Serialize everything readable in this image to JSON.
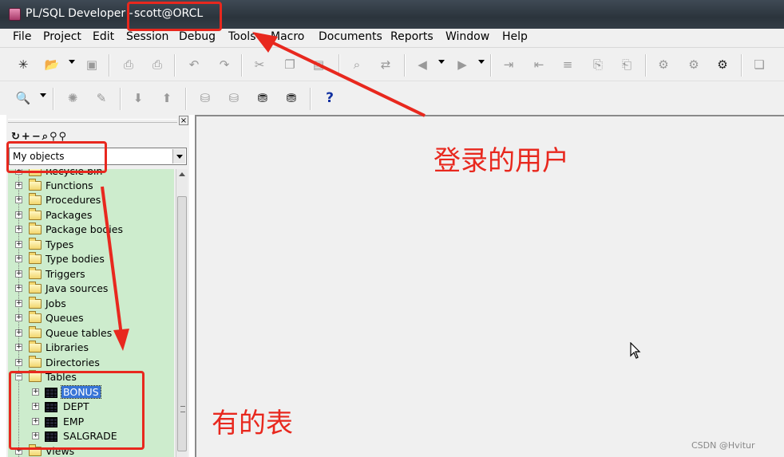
{
  "window": {
    "title_app": "PL/SQL Developer - ",
    "title_user": "scott@ORCL"
  },
  "menu": [
    "File",
    "Project",
    "Edit",
    "Session",
    "Debug",
    "Tools",
    "Macro",
    "Documents",
    "Reports",
    "Window",
    "Help"
  ],
  "toolbar1": {
    "buttons": [
      "new-icon",
      "open-icon",
      "save-icon",
      "print-icon",
      "print-preview-icon",
      "undo-icon",
      "redo-icon",
      "cut-icon",
      "copy-icon",
      "paste-icon",
      "find-icon",
      "replace-icon",
      "back-icon",
      "forward-icon",
      "indent-icon",
      "unindent-icon",
      "outdent-icon",
      "comment-icon",
      "uncomment-icon",
      "tool-a-icon",
      "tool-b-icon",
      "tool-c-icon",
      "tool-d-icon"
    ]
  },
  "toolbar2": {
    "buttons": [
      "key-icon",
      "gear-icon",
      "edit-pencil-icon",
      "import-icon",
      "export-icon",
      "database-icon",
      "sql-icon",
      "commit-icon",
      "rollback-icon",
      "help-icon"
    ],
    "help_glyph": "?"
  },
  "object_browser": {
    "filter_value": "My objects",
    "items": [
      {
        "label": "Recycle bin",
        "type": "folder"
      },
      {
        "label": "Functions",
        "type": "folder"
      },
      {
        "label": "Procedures",
        "type": "folder"
      },
      {
        "label": "Packages",
        "type": "folder"
      },
      {
        "label": "Package bodies",
        "type": "folder"
      },
      {
        "label": "Types",
        "type": "folder"
      },
      {
        "label": "Type bodies",
        "type": "folder"
      },
      {
        "label": "Triggers",
        "type": "folder"
      },
      {
        "label": "Java sources",
        "type": "folder"
      },
      {
        "label": "Jobs",
        "type": "folder"
      },
      {
        "label": "Queues",
        "type": "folder"
      },
      {
        "label": "Queue tables",
        "type": "folder"
      },
      {
        "label": "Libraries",
        "type": "folder"
      },
      {
        "label": "Directories",
        "type": "folder"
      },
      {
        "label": "Tables",
        "type": "folder-open"
      },
      {
        "label": "BONUS",
        "type": "table",
        "selected": true
      },
      {
        "label": "DEPT",
        "type": "table"
      },
      {
        "label": "EMP",
        "type": "table"
      },
      {
        "label": "SALGRADE",
        "type": "table"
      },
      {
        "label": "Views",
        "type": "folder"
      }
    ]
  },
  "annotations": {
    "logged_in_user": "登录的用户",
    "existing_tables": "有的表",
    "color": "#e8281e"
  },
  "watermark": "CSDN @Hvitur"
}
